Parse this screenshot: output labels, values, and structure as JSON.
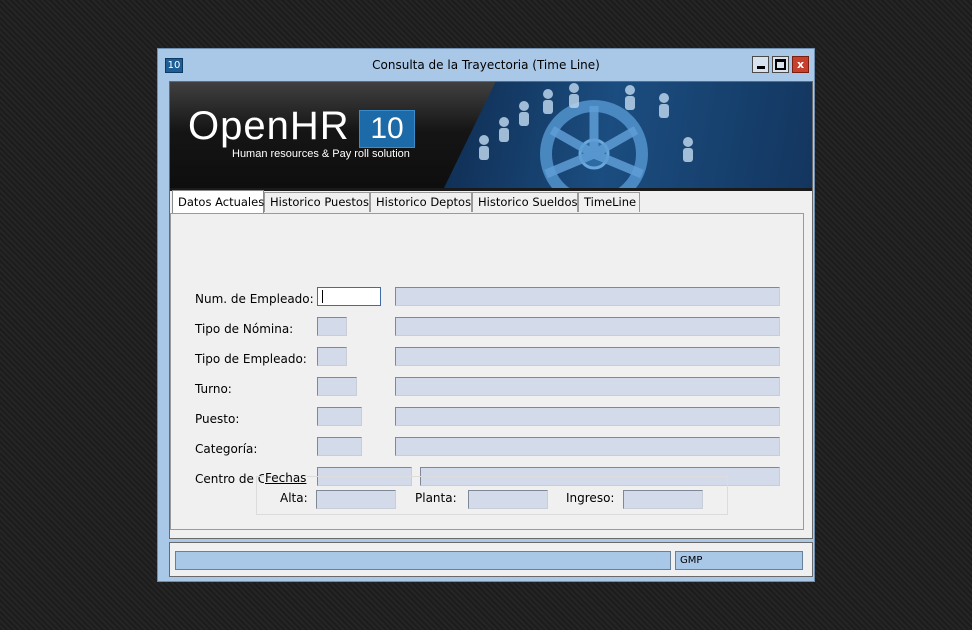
{
  "window": {
    "app_icon_label": "10",
    "title": "Consulta de la  Trayectoria (Time Line)",
    "close_label": "x"
  },
  "banner": {
    "logo_text": "OpenHR",
    "logo_badge": "10",
    "logo_subtitle": "Human resources & Pay roll solution"
  },
  "tabs": [
    {
      "label": "Datos Actuales",
      "active": true
    },
    {
      "label": "Historico Puestos",
      "active": false
    },
    {
      "label": "Historico Deptos",
      "active": false
    },
    {
      "label": "Historico Sueldos",
      "active": false
    },
    {
      "label": "TimeLine",
      "active": false
    }
  ],
  "form": {
    "num_empleado_label": "Num. de Empleado:",
    "num_empleado_value": "",
    "tipo_nomina_label": "Tipo de Nómina:",
    "tipo_empleado_label": "Tipo de Empleado:",
    "turno_label": "Turno:",
    "puesto_label": "Puesto:",
    "categoria_label": "Categoría:",
    "centro_costo_label": "Centro de Costo:"
  },
  "fechas": {
    "title": "Fechas",
    "alta_label": "Alta:",
    "planta_label": "Planta:",
    "ingreso_label": "Ingreso:"
  },
  "status": {
    "left_text": "",
    "right_text": "GMP"
  },
  "colors": {
    "window_frame": "#a9c7e6",
    "field_bg": "#d3daea",
    "logo_badge": "#1d6aa8",
    "close_button": "#c7402d"
  }
}
